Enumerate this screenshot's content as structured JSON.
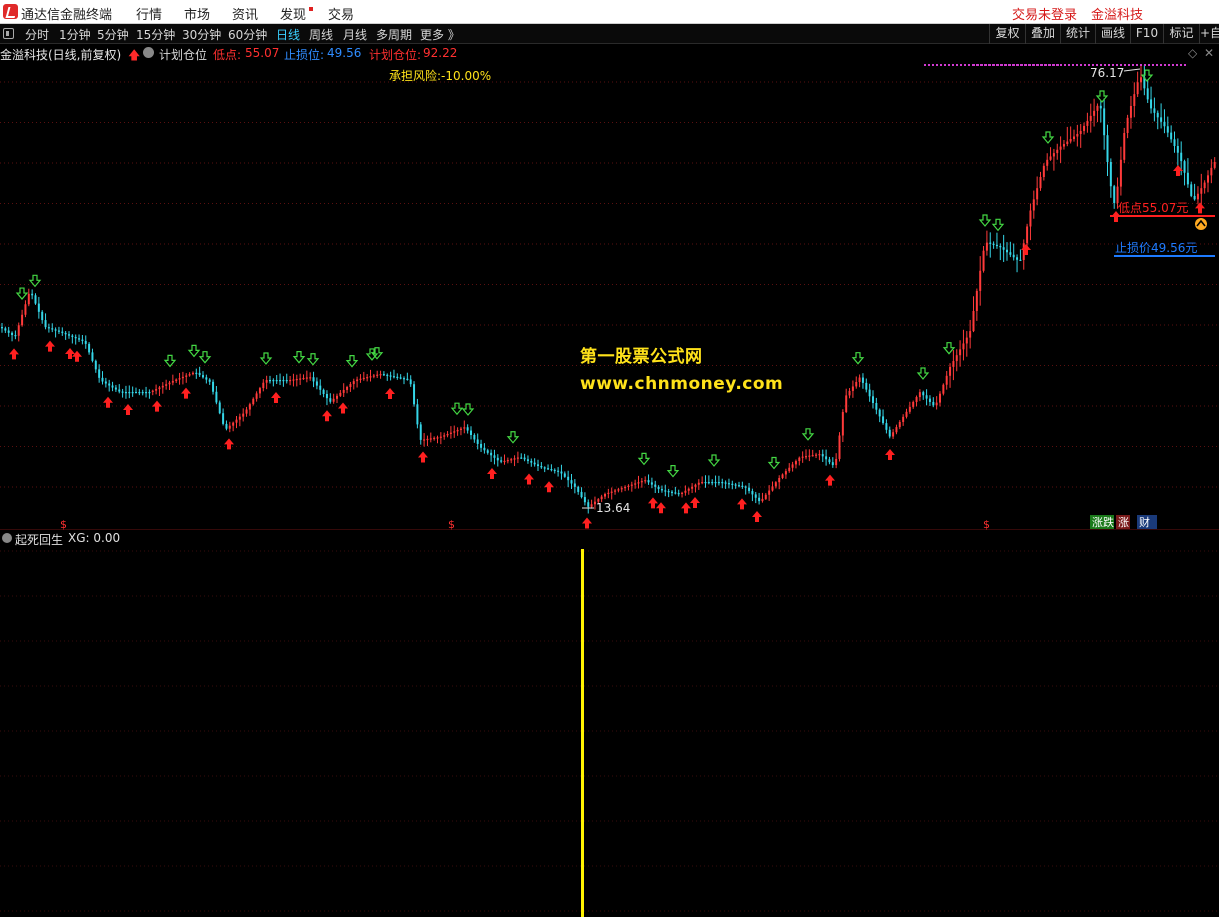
{
  "app": {
    "name": "通达信金融终端",
    "menu": [
      "行情",
      "市场",
      "资讯",
      "发现",
      "交易"
    ],
    "login_status": "交易未登录",
    "stock_link": "金溢科技"
  },
  "toolbar": {
    "periods": [
      "分时",
      "1分钟",
      "5分钟",
      "15分钟",
      "30分钟",
      "60分钟",
      "日线",
      "周线",
      "月线",
      "多周期",
      "更多 》"
    ],
    "active_period": "日线",
    "right_buttons": [
      "复权",
      "叠加",
      "统计",
      "画线",
      "F10",
      "标记",
      "+自"
    ]
  },
  "info": {
    "title": "金溢科技(日线,前复权)",
    "formula": "计划仓位",
    "low_label": "低点:",
    "low_value": "55.07",
    "stop_label": "止损位:",
    "stop_value": "49.56",
    "plan_label": "计划仓位:",
    "plan_value": "92.22",
    "risk_text": "承担风险:-10.00%"
  },
  "main_chart": {
    "high_marker": "76.17",
    "low_marker": "13.64",
    "low_point_label": "低点55.07元",
    "stop_label": "止损价49.56元",
    "watermark_line1": "第一股票公式网",
    "watermark_line2": "www.chnmoney.com",
    "bottom_markers": [
      "$",
      "$",
      "$"
    ],
    "badges": [
      "涨跌",
      "涨",
      "财"
    ],
    "colors": {
      "up": "#ff3a3a",
      "down": "#35d6e8",
      "buy_arrow": "#ff2020",
      "sell_arrow": "#44d844",
      "stop_line": "#1e7bff",
      "low_line": "#ff2020",
      "top_dots": "#d23ad2"
    }
  },
  "sub_chart": {
    "indicator": "起死回生",
    "xg_label": "XG: 0.00",
    "signal_color": "#fff200"
  }
}
